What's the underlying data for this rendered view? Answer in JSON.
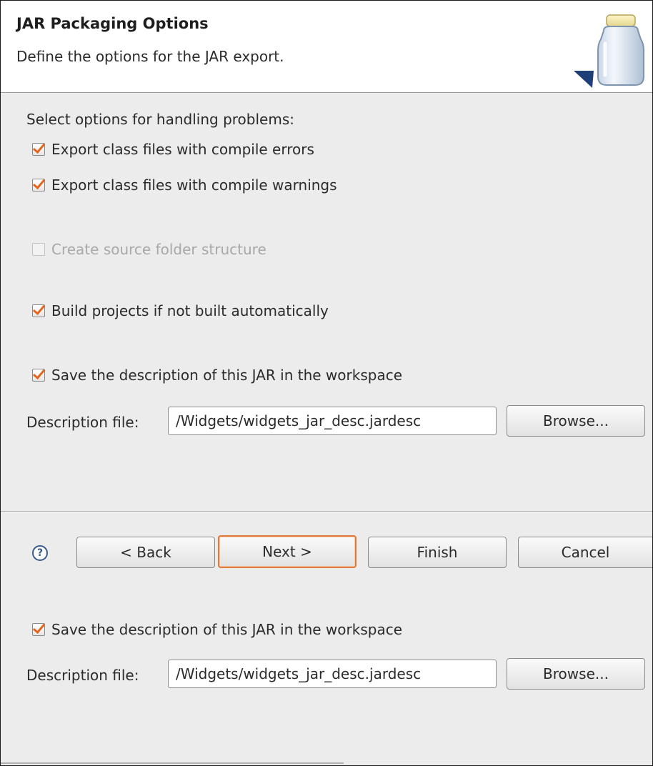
{
  "header": {
    "title": "JAR Packaging Options",
    "description": "Define the options for the JAR export."
  },
  "problems": {
    "heading": "Select options for handling problems:",
    "export_errors": {
      "label": "Export class files with compile errors",
      "checked": true
    },
    "export_warnings": {
      "label": "Export class files with compile warnings",
      "checked": true
    }
  },
  "source_folder": {
    "label": "Create source folder structure",
    "checked": false,
    "enabled": false
  },
  "build_projects": {
    "label": "Build projects if not built automatically",
    "checked": true
  },
  "save_description": {
    "label": "Save the description of this JAR in the workspace",
    "checked": true
  },
  "description_file": {
    "label": "Description file:",
    "value": "/Widgets/widgets_jar_desc.jardesc",
    "browse_label": "Browse..."
  },
  "buttons": {
    "help": "?",
    "back": "< Back",
    "next": "Next >",
    "finish": "Finish",
    "cancel": "Cancel"
  },
  "save_description_2": {
    "label": "Save the description of this JAR in the workspace",
    "checked": true
  },
  "description_file_2": {
    "label": "Description file:",
    "value": "/Widgets/widgets_jar_desc.jardesc",
    "browse_label": "Browse..."
  },
  "icons": {
    "jar": "jar-icon",
    "help": "help-icon"
  },
  "colors": {
    "accent": "#e4641c",
    "default_button_border": "#e07a3a",
    "background": "#ececec"
  }
}
